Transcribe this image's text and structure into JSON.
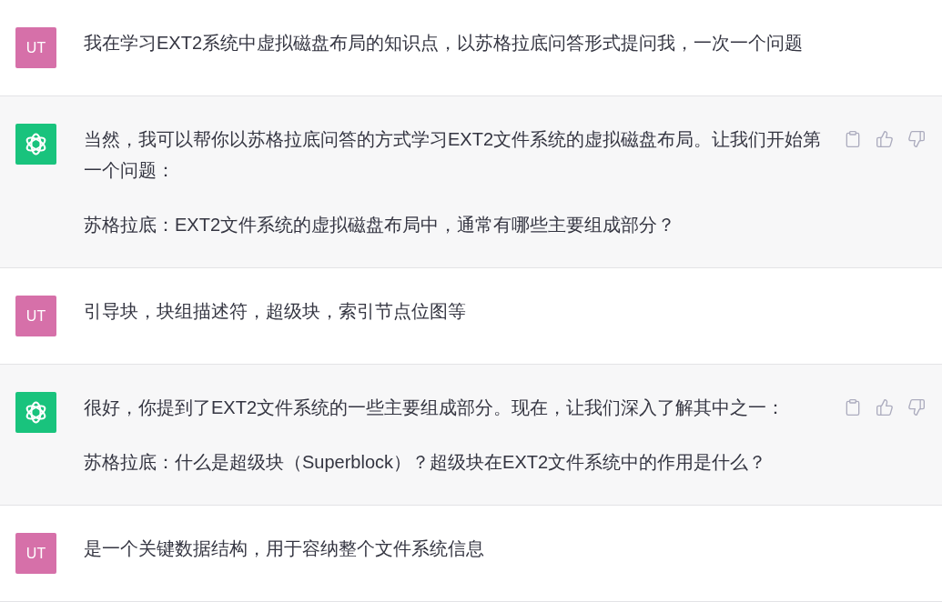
{
  "messages": [
    {
      "kind": "user",
      "avatar": "UT",
      "paragraphs": [
        "我在学习EXT2系统中虚拟磁盘布局的知识点，以苏格拉底问答形式提问我，一次一个问题"
      ]
    },
    {
      "kind": "assistant",
      "paragraphs": [
        "当然，我可以帮你以苏格拉底问答的方式学习EXT2文件系统的虚拟磁盘布局。让我们开始第一个问题：",
        "苏格拉底：EXT2文件系统的虚拟磁盘布局中，通常有哪些主要组成部分？"
      ],
      "actions": [
        {
          "kind": "copy"
        },
        {
          "kind": "thumbs_up"
        },
        {
          "kind": "thumbs_down"
        }
      ]
    },
    {
      "kind": "user",
      "avatar": "UT",
      "paragraphs": [
        "引导块，块组描述符，超级块，索引节点位图等"
      ]
    },
    {
      "kind": "assistant",
      "paragraphs": [
        "很好，你提到了EXT2文件系统的一些主要组成部分。现在，让我们深入了解其中之一：",
        "苏格拉底：什么是超级块（Superblock）？超级块在EXT2文件系统中的作用是什么？"
      ],
      "actions": [
        {
          "kind": "copy"
        },
        {
          "kind": "thumbs_up"
        },
        {
          "kind": "thumbs_down"
        }
      ]
    },
    {
      "kind": "user",
      "avatar": "UT",
      "paragraphs": [
        "是一个关键数据结构，用于容纳整个文件系统信息"
      ]
    }
  ]
}
